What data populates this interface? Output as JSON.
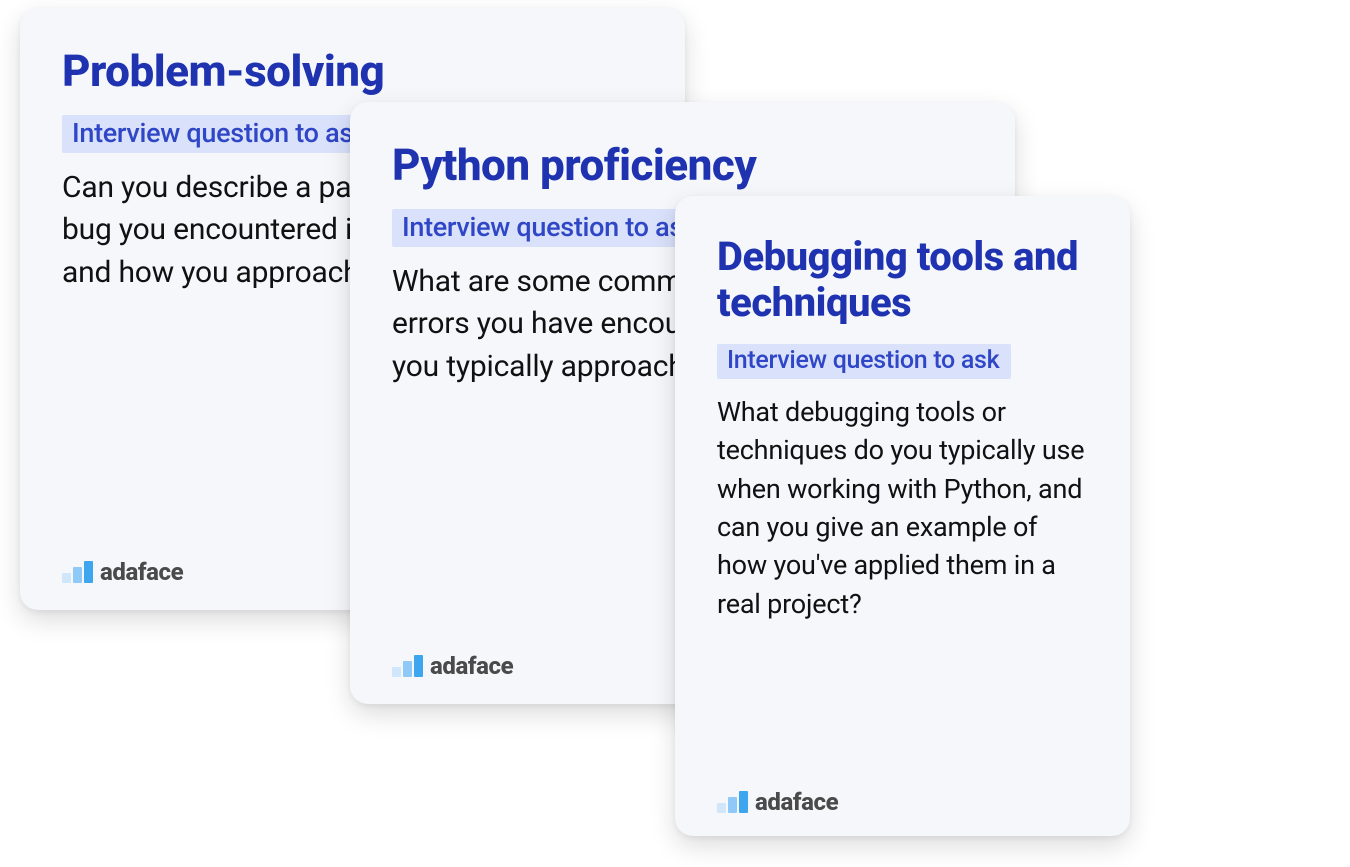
{
  "brand": "adaface",
  "cards": [
    {
      "title": "Problem-solving",
      "badge": "Interview question to ask",
      "body": "Can you describe a particularly challenging bug you encountered in a Python project and how you approached solving it?"
    },
    {
      "title": "Python proficiency",
      "badge": "Interview question to ask",
      "body": "What are some common Python-specific errors you have encountered, and how do you typically approach debugging them?"
    },
    {
      "title": "Debugging tools and techniques",
      "badge": "Interview question to ask",
      "body": "What debugging tools or techniques do you typically use when working with Python, and can you give an example of how you've applied them in a real project?"
    }
  ]
}
